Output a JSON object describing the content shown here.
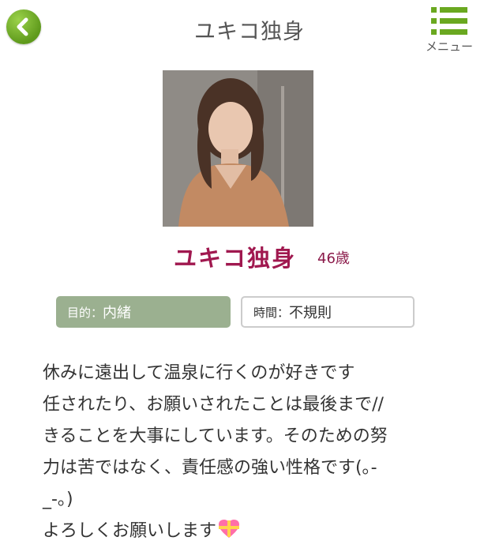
{
  "header": {
    "title": "ユキコ独身",
    "back_icon": "chevron-left-icon",
    "menu_icon": "list-menu-icon",
    "menu_label": "メニュー",
    "accent_color": "#6aa820"
  },
  "profile": {
    "photo_alt": "profile-photo",
    "name": "ユキコ独身",
    "age": "46歳",
    "name_color": "#a0184f"
  },
  "tags": {
    "purpose_key": "目的：",
    "purpose_value": "内緒",
    "time_key": "時間：",
    "time_value": "不規則"
  },
  "bio": {
    "lines": [
      "休みに遠出して温泉に行くのが好きです",
      "任されたり、お願いされたことは最後まで//",
      "きることを大事にしています。そのための努",
      "力は苦ではなく、責任感の強い性格です(｡-",
      "_-｡)",
      "よろしくお願いします"
    ],
    "emoji": "heart-gift-emoji"
  }
}
